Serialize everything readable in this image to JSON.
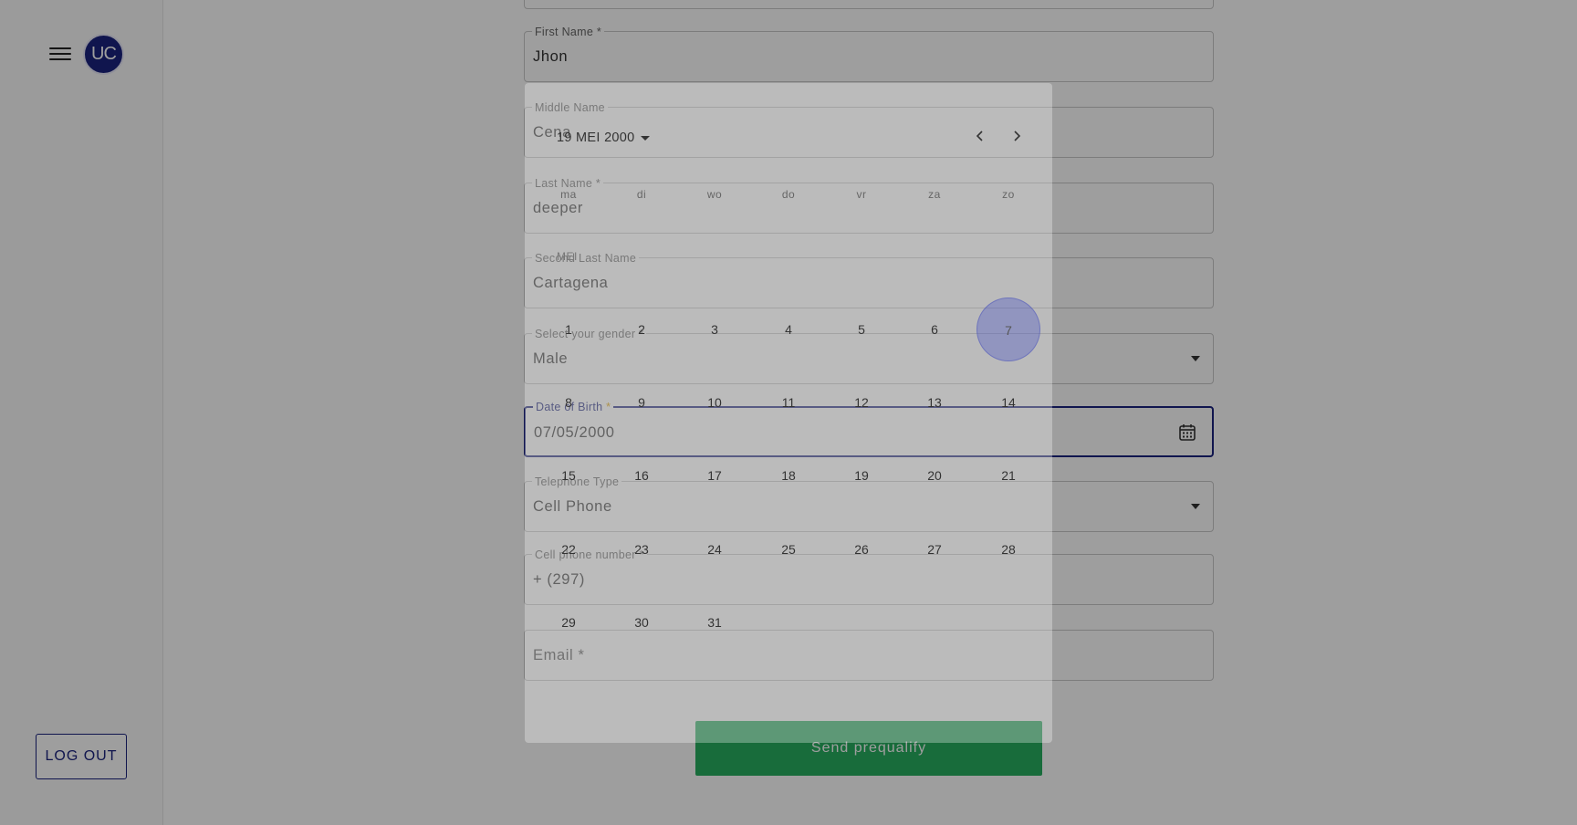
{
  "sidebar": {
    "avatar_text": "UC",
    "logout_label": "LOG OUT"
  },
  "form": {
    "first_name": {
      "label": "First Name *",
      "value": "Jhon"
    },
    "middle_name": {
      "label": "Middle Name",
      "value": "Cena"
    },
    "last_name": {
      "label": "Last Name *",
      "value": "deeper"
    },
    "second_last_name": {
      "label": "Second Last Name",
      "value": "Cartagena"
    },
    "gender": {
      "label": "Select your gender *",
      "value": "Male"
    },
    "dob": {
      "label": "Date of Birth",
      "required_mark": "*",
      "value": "07/05/2000"
    },
    "telephone_type": {
      "label": "Telephone Type",
      "value": "Cell Phone"
    },
    "cell_phone": {
      "label": "Cell phone number *",
      "value": "+ (297)"
    },
    "email": {
      "placeholder": "Email *"
    },
    "send_label": "Send prequalify"
  },
  "date_picker": {
    "month_year": "19 MEI 2000",
    "weekdays": [
      "ma",
      "di",
      "wo",
      "do",
      "vr",
      "za",
      "zo"
    ],
    "month_short": "MEI",
    "days": [
      "1",
      "2",
      "3",
      "4",
      "5",
      "6",
      "7",
      "8",
      "9",
      "10",
      "11",
      "12",
      "13",
      "14",
      "15",
      "16",
      "17",
      "18",
      "19",
      "20",
      "21",
      "22",
      "23",
      "24",
      "25",
      "26",
      "27",
      "28",
      "29",
      "30",
      "31"
    ],
    "selected_day": "7"
  },
  "colors": {
    "primary": "#1a237e",
    "send_button": "#27ae60",
    "required_mark": "#e0a000"
  }
}
